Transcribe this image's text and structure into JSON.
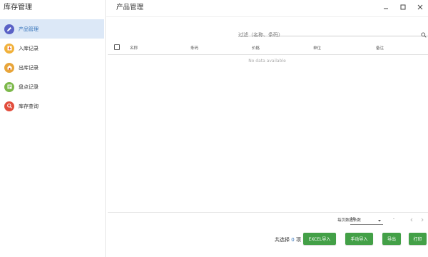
{
  "app": {
    "title": "库存管理"
  },
  "sidebar": {
    "items": [
      {
        "label": "产品管理",
        "icon": "product-edit-icon",
        "color": "#5a62c6",
        "active": true
      },
      {
        "label": "入库记录",
        "icon": "stock-in-icon",
        "color": "#f1b13b",
        "active": false
      },
      {
        "label": "出库记录",
        "icon": "stock-out-icon",
        "color": "#e8a53a",
        "active": false
      },
      {
        "label": "盘点记录",
        "icon": "inventory-check-icon",
        "color": "#7cb84a",
        "active": false
      },
      {
        "label": "库存查询",
        "icon": "stock-search-icon",
        "color": "#e24d3c",
        "active": false
      }
    ]
  },
  "main": {
    "title": "产品管理",
    "filter": {
      "placeholder": "过滤（名称、条码）",
      "value": ""
    },
    "table": {
      "columns": [
        "名称",
        "条码",
        "价格",
        "单位",
        "备注"
      ],
      "empty_text": "No data available"
    },
    "footer": {
      "rows_per_page_label": "每页数据条数",
      "rows_per_page": "10",
      "range_text": "-",
      "selected_prefix": "共选择",
      "selected_count": "0",
      "selected_suffix": "项",
      "buttons": {
        "excel_import": "EXCEL导入",
        "manual_import": "手动导入",
        "export": "导出",
        "print": "打印"
      }
    }
  },
  "colors": {
    "accent": "#2f6fb8",
    "active_bg": "#dce8f7",
    "button_green": "#43a047"
  }
}
